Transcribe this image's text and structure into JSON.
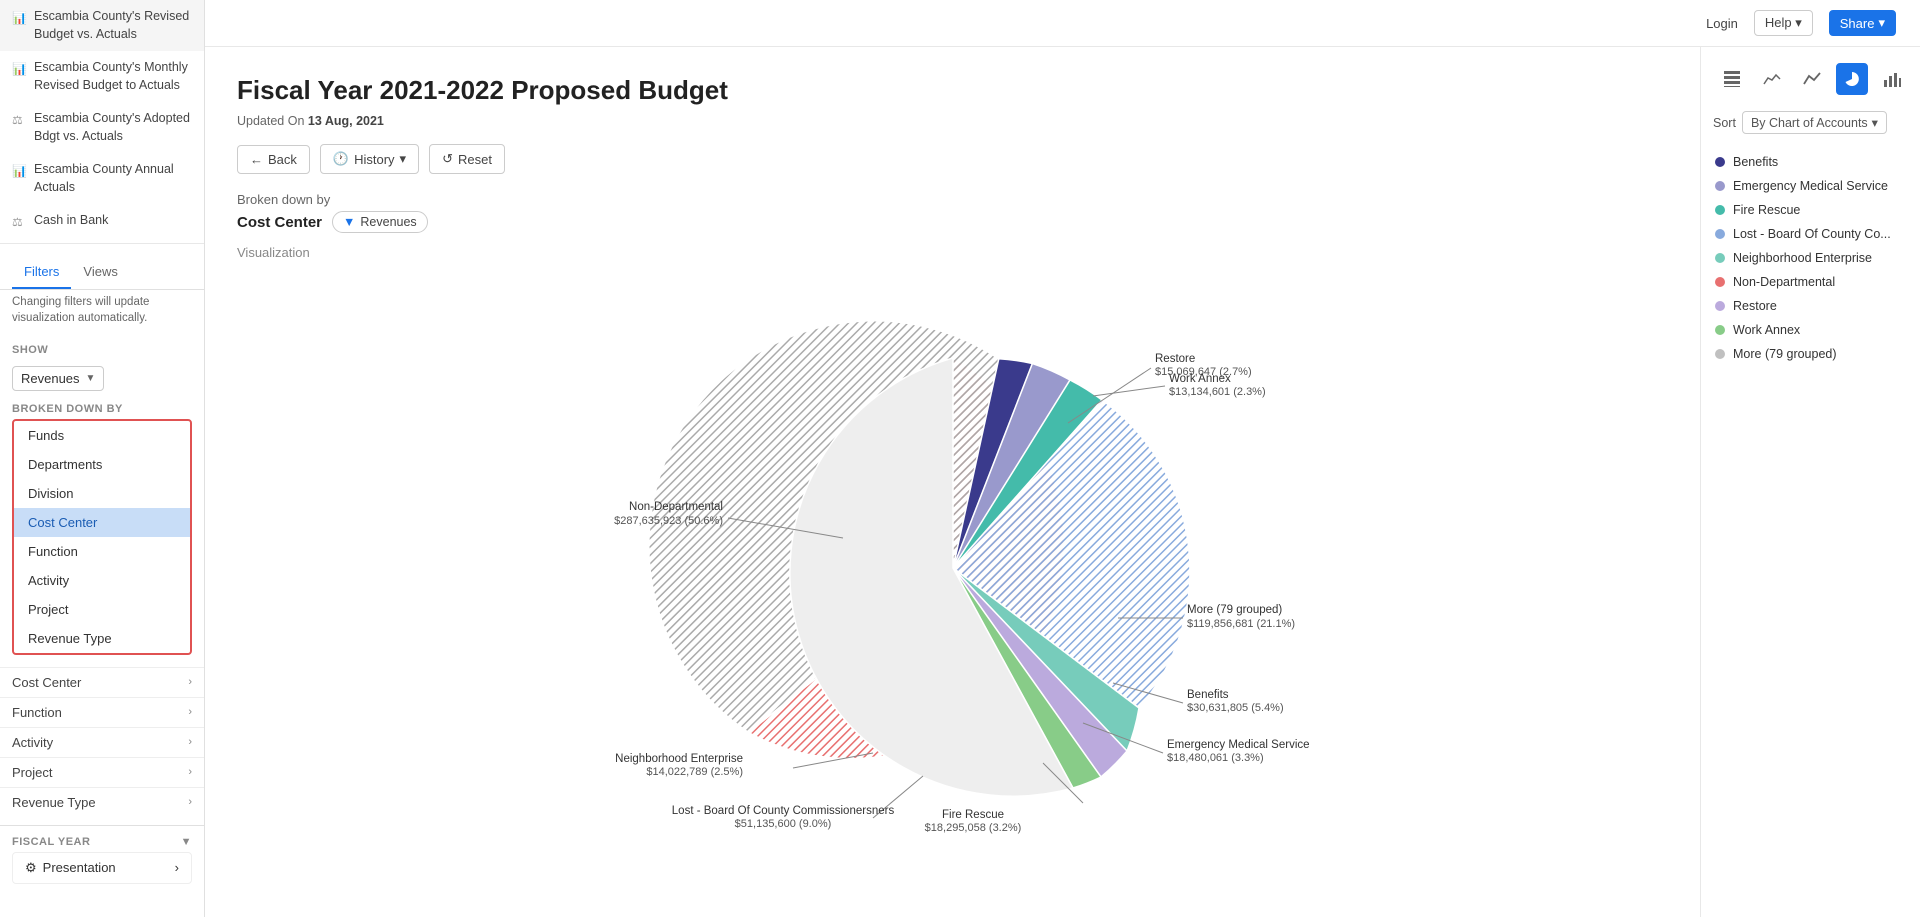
{
  "app": {
    "login": "Login",
    "help": "Help",
    "share": "Share"
  },
  "sidebar": {
    "nav_items": [
      {
        "id": "revised-budget",
        "label": "Escambia County's Revised Budget vs. Actuals",
        "icon": "📊"
      },
      {
        "id": "monthly-revised",
        "label": "Escambia County's Monthly Revised Budget to Actuals",
        "icon": "📊"
      },
      {
        "id": "adopted-budget",
        "label": "Escambia County's Adopted Bdgt vs. Actuals",
        "icon": "⚖"
      },
      {
        "id": "annual-actuals",
        "label": "Escambia County Annual Actuals",
        "icon": "📊"
      },
      {
        "id": "cash-in-bank",
        "label": "Cash in Bank",
        "icon": "⚖"
      }
    ],
    "tabs": [
      "Filters",
      "Views"
    ],
    "active_tab": "Filters",
    "filter_note": "Changing filters will update visualization automatically.",
    "show_label": "SHOW",
    "show_value": "Revenues",
    "broken_down_label": "BROKEN DOWN BY",
    "breakdown_options": [
      "Funds",
      "Departments",
      "Division",
      "Cost Center",
      "Function",
      "Activity",
      "Project",
      "Revenue Type"
    ],
    "breakdown_selected": "Cost Center",
    "filter_rows": [
      {
        "id": "cost-center",
        "label": "Cost Center"
      },
      {
        "id": "function",
        "label": "Function"
      },
      {
        "id": "activity",
        "label": "Activity"
      },
      {
        "id": "project",
        "label": "Project"
      },
      {
        "id": "revenue-type",
        "label": "Revenue Type"
      }
    ],
    "fiscal_year_label": "FISCAL YEAR",
    "presentation_label": "Presentation"
  },
  "page": {
    "title": "Fiscal Year 2021-2022 Proposed Budget",
    "updated_label": "Updated On",
    "updated_date": "13 Aug, 2021",
    "back_btn": "Back",
    "history_btn": "History",
    "reset_btn": "Reset",
    "broken_by_label": "Broken down by",
    "broken_by_value": "Cost Center",
    "filter_tag": "Revenues",
    "visualization_label": "Visualization"
  },
  "chart": {
    "segments": [
      {
        "id": "non-departmental",
        "label": "Non-Departmental",
        "value": "$287,635,923",
        "pct": "50.6%",
        "color": "#e87070",
        "hatch": true
      },
      {
        "id": "more-grouped",
        "label": "More (79 grouped)",
        "value": "$119,856,681",
        "pct": "21.1%",
        "color": "#c0c0c0",
        "hatch": true
      },
      {
        "id": "benefits",
        "label": "Benefits",
        "value": "$30,631,805",
        "pct": "5.4%",
        "color": "#3a3a8c"
      },
      {
        "id": "ems",
        "label": "Emergency Medical Service",
        "value": "$18,480,061",
        "pct": "3.3%",
        "color": "#8888cc"
      },
      {
        "id": "fire-rescue",
        "label": "Fire Rescue",
        "value": "$18,295,058",
        "pct": "3.2%",
        "color": "#44bbaa"
      },
      {
        "id": "lost-board",
        "label": "Lost - Board Of County Commissioners",
        "value": "$51,135,600",
        "pct": "9.0%",
        "color": "#88aadd"
      },
      {
        "id": "neighborhood",
        "label": "Neighborhood Enterprise",
        "value": "$14,022,789",
        "pct": "2.5%",
        "color": "#77ccbb"
      },
      {
        "id": "restore",
        "label": "Restore",
        "value": "$15,069,647",
        "pct": "2.7%",
        "color": "#bbaadd"
      },
      {
        "id": "work-annex",
        "label": "Work Annex",
        "value": "$13,134,601",
        "pct": "2.3%",
        "color": "#88cc88"
      }
    ],
    "labels_outside": [
      {
        "id": "non-departmental-lbl",
        "text": "Non-Departmental",
        "sub": "$287,635,923 (50.6%)",
        "pos": "left"
      },
      {
        "id": "neighborhood-lbl",
        "text": "Neighborhood Enterprise",
        "sub": "$14,022,789 (2.5%)",
        "pos": "bottom-left"
      },
      {
        "id": "lost-lbl",
        "text": "Lost - Board Of County Commissionersners",
        "sub": "$51,135,600 (9.0%)",
        "pos": "bottom"
      },
      {
        "id": "fire-rescue-lbl",
        "text": "Fire Rescue",
        "sub": "$18,295,058 (3.2%)",
        "pos": "bottom-right"
      },
      {
        "id": "ems-lbl",
        "text": "Emergency Medical Service",
        "sub": "$18,480,061 (3.3%)",
        "pos": "right-bottom"
      },
      {
        "id": "benefits-lbl",
        "text": "Benefits",
        "sub": "$30,631,805 (5.4%)",
        "pos": "right"
      },
      {
        "id": "more-lbl",
        "text": "More (79 grouped)",
        "sub": "$119,856,681 (21.1%)",
        "pos": "right"
      },
      {
        "id": "restore-lbl",
        "text": "Restore",
        "sub": "$15,069,647 (2.7%)",
        "pos": "top-right"
      },
      {
        "id": "work-annex-lbl",
        "text": "Work Annex",
        "sub": "$13,134,601 (2.3%)",
        "pos": "top-right"
      }
    ]
  },
  "right_panel": {
    "sort_label": "Sort",
    "sort_value": "By Chart of Accounts",
    "legend": [
      {
        "id": "benefits",
        "label": "Benefits",
        "color": "#3a3a8c"
      },
      {
        "id": "ems",
        "label": "Emergency Medical Service",
        "color": "#9999cc"
      },
      {
        "id": "fire-rescue",
        "label": "Fire Rescue",
        "color": "#44bbaa"
      },
      {
        "id": "lost-board",
        "label": "Lost - Board Of County Co...",
        "color": "#88aadd"
      },
      {
        "id": "neighborhood",
        "label": "Neighborhood Enterprise",
        "color": "#77ccbb"
      },
      {
        "id": "non-departmental",
        "label": "Non-Departmental",
        "color": "#e87070"
      },
      {
        "id": "restore",
        "label": "Restore",
        "color": "#bbaadd"
      },
      {
        "id": "work-annex",
        "label": "Work Annex",
        "color": "#88cc88"
      },
      {
        "id": "more-grouped",
        "label": "More (79 grouped)",
        "color": "#c0c0c0"
      }
    ]
  }
}
